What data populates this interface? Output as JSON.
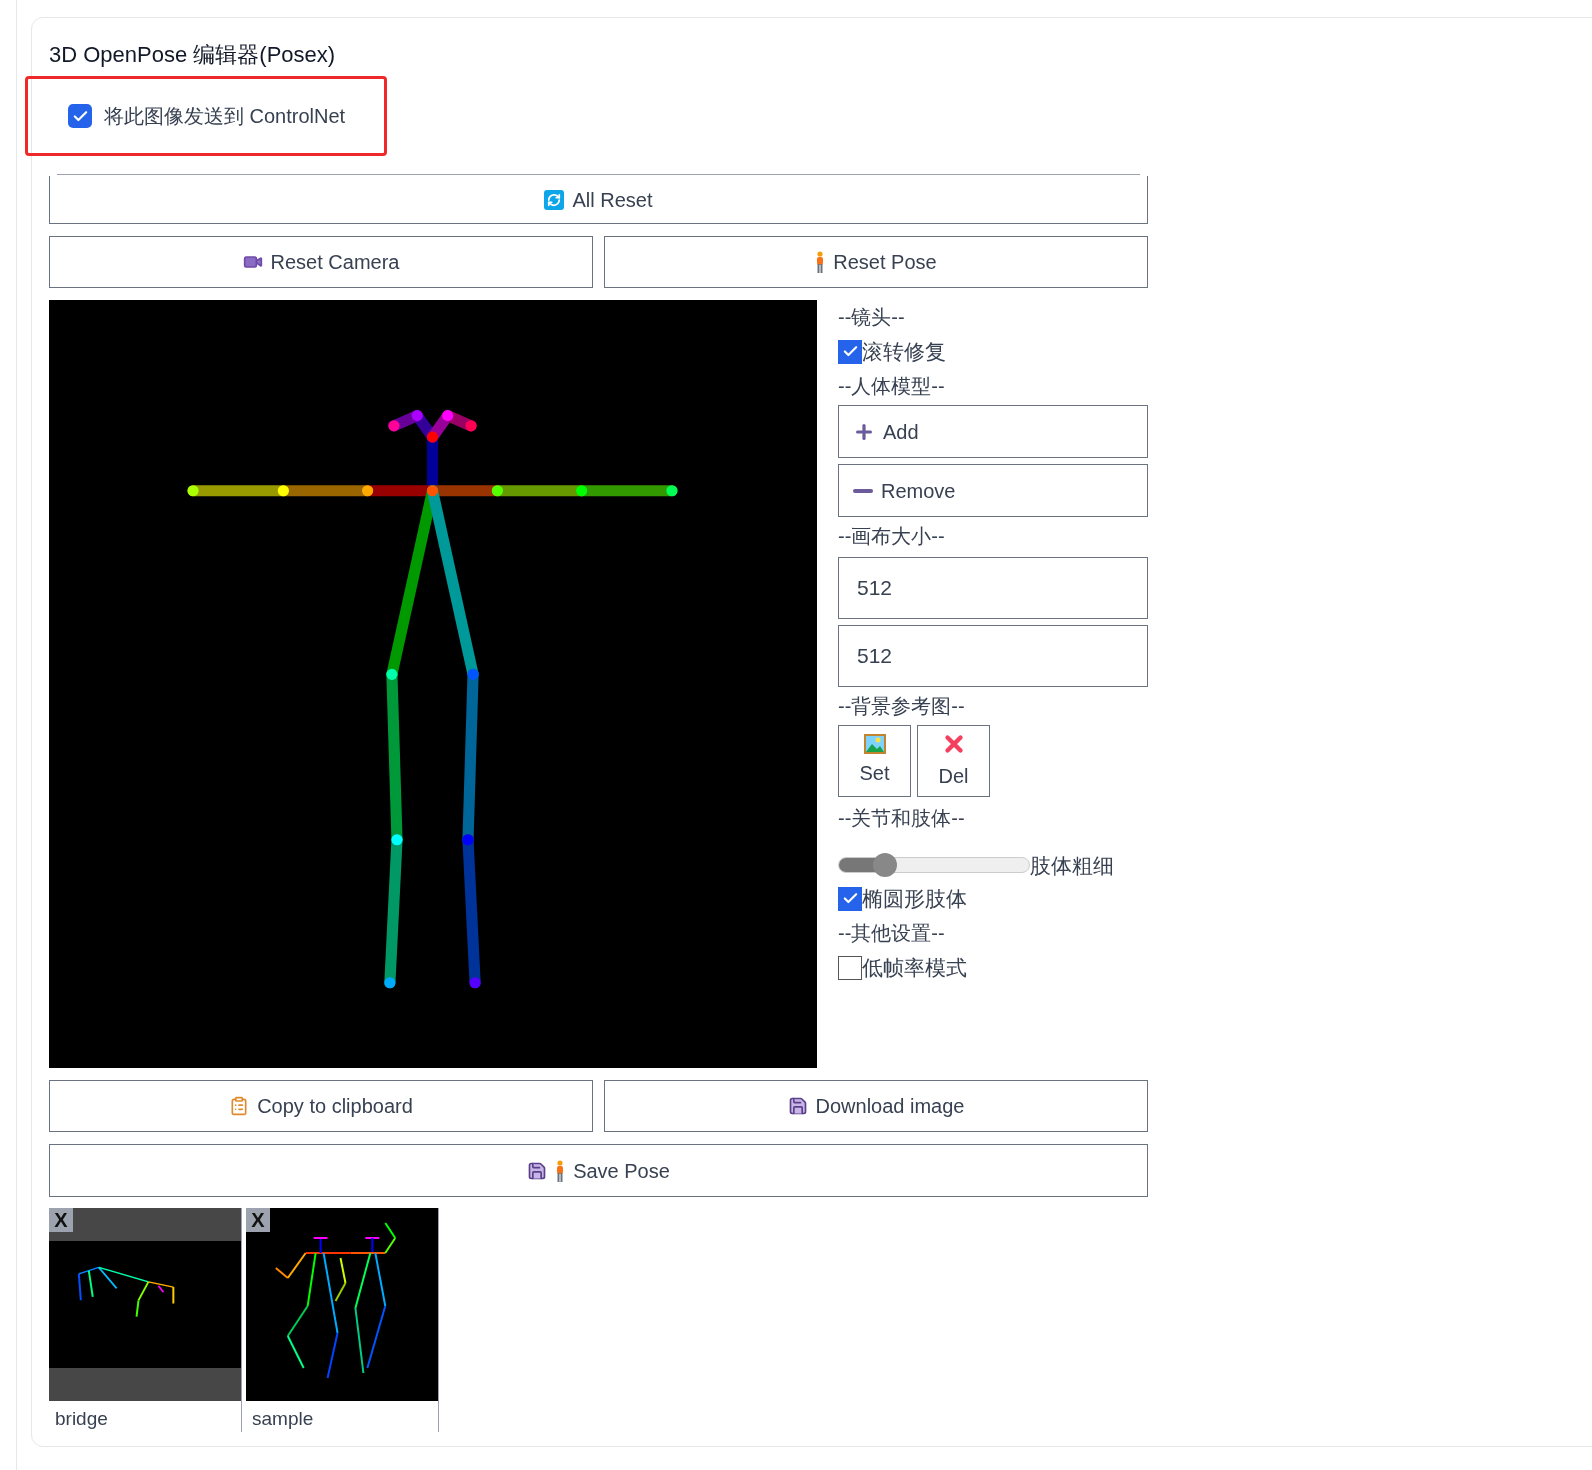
{
  "title": "3D OpenPose 编辑器(Posex)",
  "send_checkbox": {
    "label": "将此图像发送到 ControlNet",
    "checked": true
  },
  "all_reset": "All Reset",
  "reset_camera": "Reset Camera",
  "reset_pose": "Reset Pose",
  "camera_heading": "--镜头--",
  "roll_fix": {
    "label": "滚转修复",
    "checked": true
  },
  "model_heading": "--人体模型--",
  "add_button": "Add",
  "remove_button": "Remove",
  "canvas_heading": "--画布大小--",
  "width_field": {
    "value": "512"
  },
  "height_field": {
    "value": "512"
  },
  "background_heading": "--背景参考图--",
  "set_button": "Set",
  "del_button": "Del",
  "joints_heading": "--关节和肢体--",
  "limb_width": {
    "label": "肢体粗细",
    "level": 0.24
  },
  "ellipse_limbs": {
    "label": "椭圆形肢体",
    "checked": true
  },
  "other_heading": "--其他设置--",
  "low_fps": {
    "label": "低帧率模式",
    "checked": false
  },
  "copy_button": "Copy to clipboard",
  "download_button": "Download image",
  "save_pose_button": "Save Pose",
  "presets": [
    {
      "name": "bridge",
      "close": "X",
      "letterboxed": true
    },
    {
      "name": "sample",
      "close": "X",
      "letterboxed": false
    }
  ]
}
